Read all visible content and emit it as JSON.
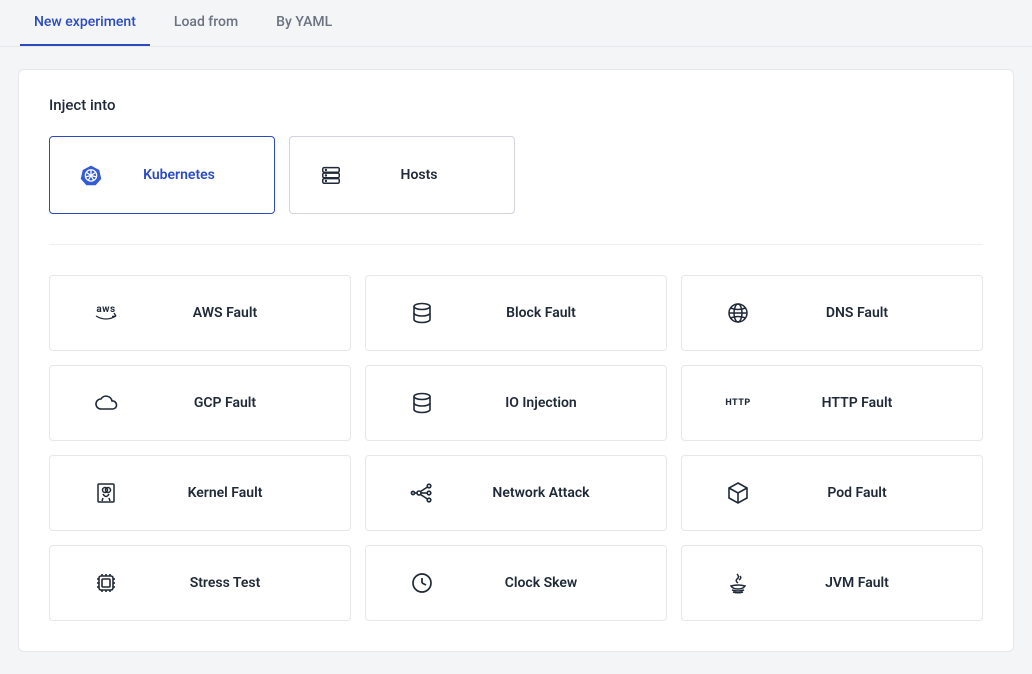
{
  "tabs": [
    {
      "id": "new",
      "label": "New experiment",
      "active": true
    },
    {
      "id": "load",
      "label": "Load from",
      "active": false
    },
    {
      "id": "yaml",
      "label": "By YAML",
      "active": false
    }
  ],
  "section_title": "Inject into",
  "targets": [
    {
      "id": "kubernetes",
      "label": "Kubernetes",
      "icon": "kubernetes-icon",
      "active": true
    },
    {
      "id": "hosts",
      "label": "Hosts",
      "icon": "hosts-icon",
      "active": false
    }
  ],
  "faults": [
    {
      "id": "aws",
      "label": "AWS Fault",
      "icon": "aws-icon"
    },
    {
      "id": "block",
      "label": "Block Fault",
      "icon": "block-icon"
    },
    {
      "id": "dns",
      "label": "DNS Fault",
      "icon": "dns-icon"
    },
    {
      "id": "gcp",
      "label": "GCP Fault",
      "icon": "gcp-icon"
    },
    {
      "id": "io",
      "label": "IO Injection",
      "icon": "io-icon"
    },
    {
      "id": "http",
      "label": "HTTP Fault",
      "icon": "http-icon"
    },
    {
      "id": "kernel",
      "label": "Kernel Fault",
      "icon": "kernel-icon"
    },
    {
      "id": "network",
      "label": "Network Attack",
      "icon": "network-icon"
    },
    {
      "id": "pod",
      "label": "Pod Fault",
      "icon": "pod-icon"
    },
    {
      "id": "stress",
      "label": "Stress Test",
      "icon": "stress-icon"
    },
    {
      "id": "clock",
      "label": "Clock Skew",
      "icon": "clock-icon"
    },
    {
      "id": "jvm",
      "label": "JVM Fault",
      "icon": "jvm-icon"
    }
  ]
}
